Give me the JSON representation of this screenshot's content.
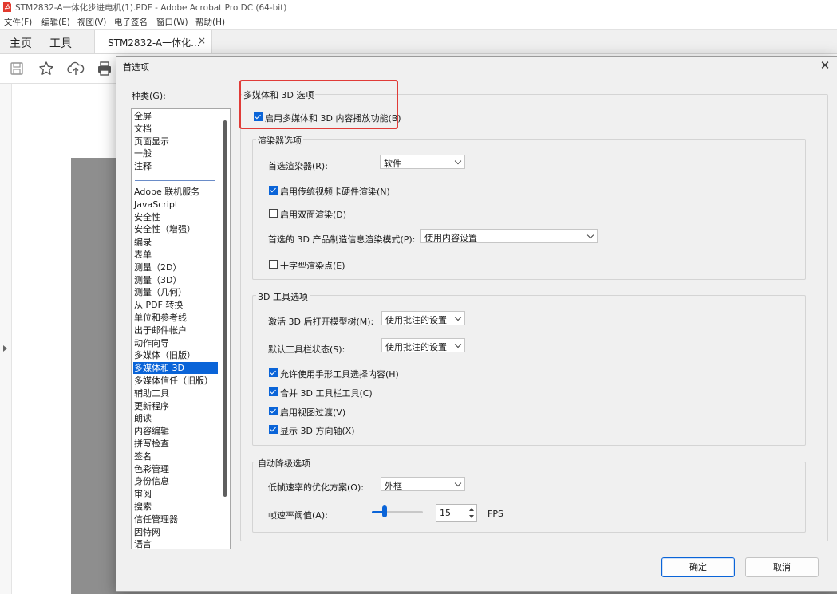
{
  "window": {
    "title": "STM2832-A一体化步进电机(1).PDF - Adobe Acrobat Pro DC (64-bit)"
  },
  "menu": [
    "文件(F)",
    "编辑(E)",
    "视图(V)",
    "电子签名",
    "窗口(W)",
    "帮助(H)"
  ],
  "tabs": {
    "home": "主页",
    "tools": "工具",
    "doc": "STM2832-A一体化...",
    "doc_close": "×"
  },
  "toolbar_icons": [
    "save-icon",
    "star-icon",
    "cloud-upload-icon",
    "print-icon"
  ],
  "dialog": {
    "title": "首选项",
    "close": "✕",
    "category_label": "种类(G):",
    "categories_top": [
      "全屏",
      "文档",
      "页面显示",
      "一般",
      "注释"
    ],
    "categories": [
      "Adobe 联机服务",
      "JavaScript",
      "安全性",
      "安全性（增强）",
      "编录",
      "表单",
      "测量（2D）",
      "测量（3D）",
      "测量（几何）",
      "从 PDF 转换",
      "单位和参考线",
      "出于邮件帐户",
      "动作向导",
      "多媒体（旧版）",
      "多媒体和 3D",
      "多媒体信任（旧版）",
      "辅助工具",
      "更新程序",
      "朗读",
      "内容编辑",
      "拼写检查",
      "签名",
      "色彩管理",
      "身份信息",
      "审阅",
      "搜索",
      "信任管理器",
      "因特网",
      "语言"
    ],
    "selected_category": "多媒体和 3D",
    "section_title": "多媒体和 3D 选项",
    "enable_multimedia": {
      "label": "启用多媒体和 3D 内容播放功能(B)",
      "checked": true
    },
    "renderer_group": {
      "title": "渲染器选项",
      "preferred_renderer_label": "首选渲染器(R):",
      "preferred_renderer_value": "软件",
      "hw_render": {
        "label": "启用传统视频卡硬件渲染(N)",
        "checked": true
      },
      "double_sided": {
        "label": "启用双面渲染(D)",
        "checked": false
      },
      "pmi_mode_label": "首选的 3D 产品制造信息渲染模式(P):",
      "pmi_mode_value": "使用内容设置",
      "crosshair": {
        "label": "十字型渲染点(E)",
        "checked": false
      }
    },
    "tools_group": {
      "title": "3D 工具选项",
      "open_tree_label": "激活 3D 后打开模型树(M):",
      "open_tree_value": "使用批注的设置",
      "toolbar_state_label": "默认工具栏状态(S):",
      "toolbar_state_value": "使用批注的设置",
      "hand_tool": {
        "label": "允许使用手形工具选择内容(H)",
        "checked": true
      },
      "merge_toolbar": {
        "label": "合并 3D 工具栏工具(C)",
        "checked": true
      },
      "view_transitions": {
        "label": "启用视图过渡(V)",
        "checked": true
      },
      "show_axes": {
        "label": "显示 3D 方向轴(X)",
        "checked": true
      }
    },
    "auto_degrade_group": {
      "title": "自动降级选项",
      "low_fps_label": "低帧速率的优化方案(O):",
      "low_fps_value": "外框",
      "fps_threshold_label": "帧速率阈值(A):",
      "fps_value": "15",
      "fps_unit": "FPS",
      "fps_slider_fraction": 0.25
    },
    "ok_label": "确定",
    "cancel_label": "取消"
  },
  "colors": {
    "accent": "#0a64d8",
    "highlight_box": "#e03b37"
  }
}
